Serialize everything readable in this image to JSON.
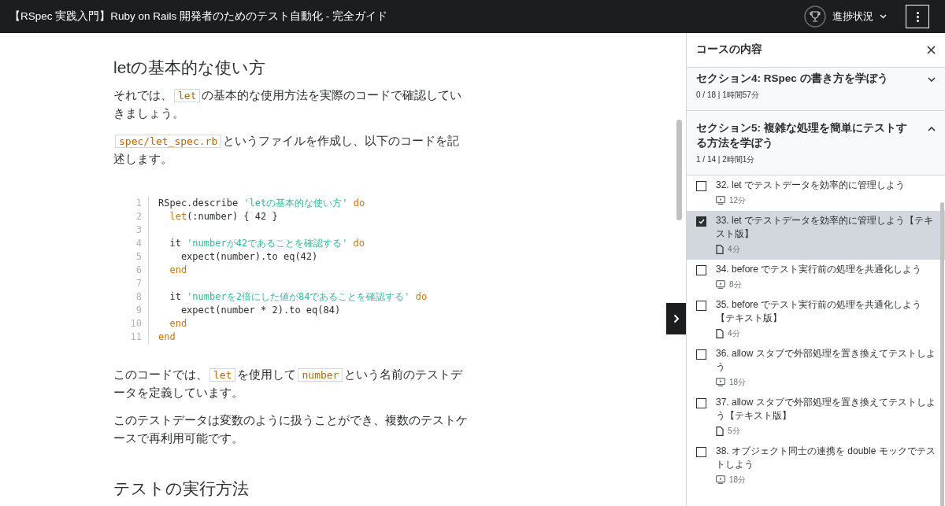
{
  "header": {
    "title": "【RSpec 実践入門】Ruby on Rails 開発者のためのテスト自動化 - 完全ガイド",
    "progress_label": "進捗状況"
  },
  "article": [
    {
      "kind": "heading",
      "text": "letの基本的な使い方"
    },
    {
      "kind": "paragraph",
      "parts": [
        {
          "kind": "text",
          "text": "それでは、"
        },
        {
          "kind": "code",
          "text": "let"
        },
        {
          "kind": "text",
          "text": "の基本的な使用方法を実際のコードで確認していきましょう。"
        }
      ]
    },
    {
      "kind": "paragraph",
      "parts": [
        {
          "kind": "code",
          "text": "spec/let_spec.rb"
        },
        {
          "kind": "text",
          "text": "というファイルを作成し、以下のコードを記述します。"
        }
      ]
    },
    {
      "kind": "code",
      "lines": [
        {
          "number": "1",
          "tokens": [
            {
              "kind": "plain",
              "text": "RSpec.describe "
            },
            {
              "kind": "string",
              "text": "'letの基本的な使い方'"
            },
            {
              "kind": "keyword",
              "text": " do"
            }
          ]
        },
        {
          "number": "2",
          "tokens": [
            {
              "kind": "keyword",
              "text": "  let"
            },
            {
              "kind": "plain",
              "text": "(:number) { 42 }"
            }
          ]
        },
        {
          "number": "3"
        },
        {
          "number": "4",
          "tokens": [
            {
              "kind": "plain",
              "text": "  it "
            },
            {
              "kind": "string",
              "text": "'numberが42であることを確認する'"
            },
            {
              "kind": "keyword",
              "text": " do"
            }
          ]
        },
        {
          "number": "5",
          "tokens": [
            {
              "kind": "plain",
              "text": "    expect(number).to eq(42)"
            }
          ]
        },
        {
          "number": "6",
          "tokens": [
            {
              "kind": "keyword",
              "text": "  end"
            }
          ]
        },
        {
          "number": "7"
        },
        {
          "number": "8",
          "tokens": [
            {
              "kind": "plain",
              "text": "  it "
            },
            {
              "kind": "string",
              "text": "'numberを2倍にした値が84であることを確認する'"
            },
            {
              "kind": "keyword",
              "text": " do"
            }
          ]
        },
        {
          "number": "9",
          "tokens": [
            {
              "kind": "plain",
              "text": "    expect(number * 2).to eq(84)"
            }
          ]
        },
        {
          "number": "10",
          "tokens": [
            {
              "kind": "keyword",
              "text": "  end"
            }
          ]
        },
        {
          "number": "11",
          "tokens": [
            {
              "kind": "keyword",
              "text": "end"
            }
          ]
        }
      ]
    },
    {
      "kind": "paragraph",
      "parts": [
        {
          "kind": "text",
          "text": "このコードでは、"
        },
        {
          "kind": "code",
          "text": "let"
        },
        {
          "kind": "text",
          "text": "を使用して"
        },
        {
          "kind": "code",
          "text": "number"
        },
        {
          "kind": "text",
          "text": "という名前のテストデータを定義しています。"
        }
      ]
    },
    {
      "kind": "paragraph",
      "parts": [
        {
          "kind": "text",
          "text": "このテストデータは変数のように扱うことができ、複数のテストケースで再利用可能です。"
        }
      ]
    },
    {
      "kind": "heading",
      "text": "テストの実行方法"
    }
  ],
  "sidebar": {
    "title": "コースの内容",
    "sections": [
      {
        "title": "セクション4: RSpec の書き方を学ぼう",
        "meta": "0 / 18 | 1時間57分",
        "expanded": false
      },
      {
        "title": "セクション5: 複雑な処理を簡単にテストする方法を学ぼう",
        "meta": "1 / 14 | 2時間1分",
        "expanded": true,
        "items": [
          {
            "title": "32. let でテストデータを効率的に管理しよう",
            "kind": "video",
            "duration": "12分",
            "checked": false,
            "selected": false
          },
          {
            "title": "33. let でテストデータを効率的に管理しよう【テキスト版】",
            "kind": "article",
            "duration": "4分",
            "checked": true,
            "selected": true
          },
          {
            "title": "34. before でテスト実行前の処理を共通化しよう",
            "kind": "video",
            "duration": "8分",
            "checked": false,
            "selected": false
          },
          {
            "title": "35. before でテスト実行前の処理を共通化しよう【テキスト版】",
            "kind": "article",
            "duration": "4分",
            "checked": false,
            "selected": false
          },
          {
            "title": "36. allow スタブで外部処理を置き換えてテストしよう",
            "kind": "video",
            "duration": "18分",
            "checked": false,
            "selected": false
          },
          {
            "title": "37. allow スタブで外部処理を置き換えてテストしよう【テキスト版】",
            "kind": "article",
            "duration": "5分",
            "checked": false,
            "selected": false
          },
          {
            "title": "38. オブジェクト同士の連携を double モックでテストしよう",
            "kind": "video",
            "duration": "18分",
            "checked": false,
            "selected": false
          }
        ]
      }
    ]
  }
}
